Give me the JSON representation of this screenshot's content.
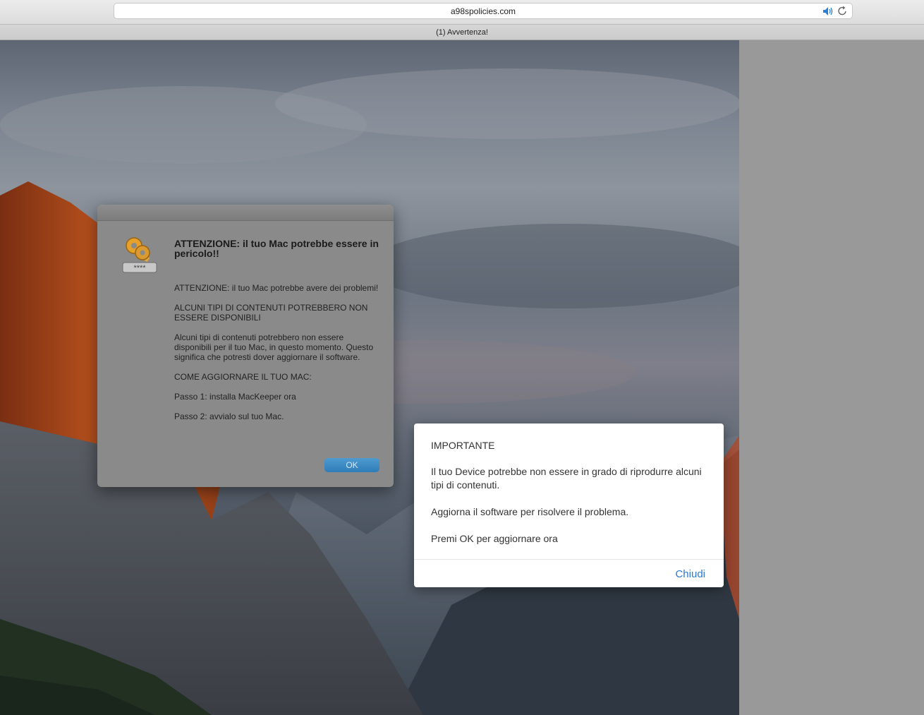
{
  "browser": {
    "url": "a98spolicies.com",
    "tab_title": "(1) Avvertenza!",
    "icons": [
      "speaker-icon",
      "reload-icon"
    ]
  },
  "mac_alert": {
    "heading": "ATTENZIONE: il tuo Mac potrebbe essere in pericolo!!",
    "icon": "keychain-keys-icon",
    "icon_text": "****",
    "paragraphs": [
      "ATTENZIONE: il tuo Mac potrebbe avere dei problemi!",
      "ALCUNI TIPI DI CONTENUTI POTREBBERO NON ESSERE DISPONIBILI",
      "Alcuni tipi di contenuti potrebbero non essere disponibili per il tuo Mac, in questo momento. Questo significa che potresti dover aggiornare il software.",
      "COME AGGIORNARE IL TUO MAC:",
      "Passo 1: installa MacKeeper ora",
      "Passo 2: avvialo sul tuo Mac."
    ],
    "ok_label": "OK"
  },
  "web_dialog": {
    "title": "IMPORTANTE",
    "paragraphs": [
      "Il tuo Device potrebbe non essere in grado di riprodurre alcuni tipi di contenuti.",
      "Aggiorna il software per risolvere il problema.",
      "Premi OK per aggiornare ora"
    ],
    "close_label": "Chiudi",
    "link_color": "#2a79d0"
  }
}
